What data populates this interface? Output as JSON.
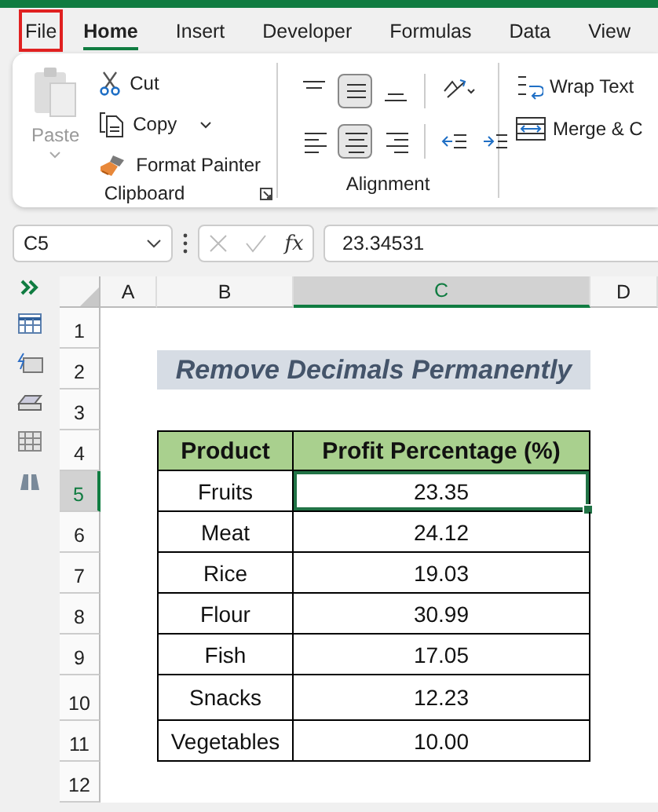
{
  "tabs": [
    {
      "label": "File",
      "selected": false,
      "highlighted": true
    },
    {
      "label": "Home",
      "selected": true,
      "highlighted": false
    },
    {
      "label": "Insert",
      "selected": false,
      "highlighted": false
    },
    {
      "label": "Developer",
      "selected": false,
      "highlighted": false
    },
    {
      "label": "Formulas",
      "selected": false,
      "highlighted": false
    },
    {
      "label": "Data",
      "selected": false,
      "highlighted": false
    },
    {
      "label": "View",
      "selected": false,
      "highlighted": false
    }
  ],
  "clipboard": {
    "paste": {
      "label": "Paste",
      "disabled": true
    },
    "items": [
      {
        "kind": "cut",
        "label": "Cut"
      },
      {
        "kind": "copy",
        "label": "Copy"
      },
      {
        "kind": "painter",
        "label": "Format Painter"
      }
    ],
    "group_label": "Clipboard"
  },
  "alignment": {
    "rows": [
      [
        {
          "kind": "top",
          "selected": false
        },
        {
          "kind": "middle",
          "selected": true
        },
        {
          "kind": "bottom",
          "selected": false
        },
        {
          "kind": "orientation",
          "selected": false
        }
      ],
      [
        {
          "kind": "left",
          "selected": false
        },
        {
          "kind": "center",
          "selected": true
        },
        {
          "kind": "right",
          "selected": false
        },
        {
          "kind": "outdent",
          "selected": false
        },
        {
          "kind": "indent",
          "selected": false
        }
      ]
    ],
    "group_label": "Alignment"
  },
  "wrap_merge": [
    {
      "kind": "wrap",
      "label": "Wrap Text"
    },
    {
      "kind": "merge",
      "label": "Merge & C"
    }
  ],
  "formula_bar": {
    "name_box": "C5",
    "fx": "fx",
    "value": "23.34531"
  },
  "sheet": {
    "columns": [
      {
        "label": "A",
        "selected": false
      },
      {
        "label": "B",
        "selected": false
      },
      {
        "label": "C",
        "selected": true
      },
      {
        "label": "D",
        "selected": false
      }
    ],
    "rows": [
      {
        "label": "1",
        "selected": false
      },
      {
        "label": "2",
        "selected": false
      },
      {
        "label": "3",
        "selected": false
      },
      {
        "label": "4",
        "selected": false
      },
      {
        "label": "5",
        "selected": true
      },
      {
        "label": "6",
        "selected": false
      },
      {
        "label": "7",
        "selected": false
      },
      {
        "label": "8",
        "selected": false
      },
      {
        "label": "9",
        "selected": false
      },
      {
        "label": "10",
        "selected": false
      },
      {
        "label": "11",
        "selected": false
      },
      {
        "label": "12",
        "selected": false
      }
    ],
    "title": "Remove Decimals Permanently",
    "table": {
      "columns": [
        "Product",
        "Profit Percentage (%)"
      ],
      "rows": [
        {
          "product": "Fruits",
          "profit": "23.35",
          "selected": true
        },
        {
          "product": "Meat",
          "profit": "24.12",
          "selected": false
        },
        {
          "product": "Rice",
          "profit": "19.03",
          "selected": false
        },
        {
          "product": "Flour",
          "profit": "30.99",
          "selected": false
        },
        {
          "product": "Fish",
          "profit": "17.05",
          "selected": false
        },
        {
          "product": "Snacks",
          "profit": "12.23",
          "selected": false
        },
        {
          "product": "Vegetables",
          "profit": "10.00",
          "selected": false
        }
      ]
    }
  }
}
